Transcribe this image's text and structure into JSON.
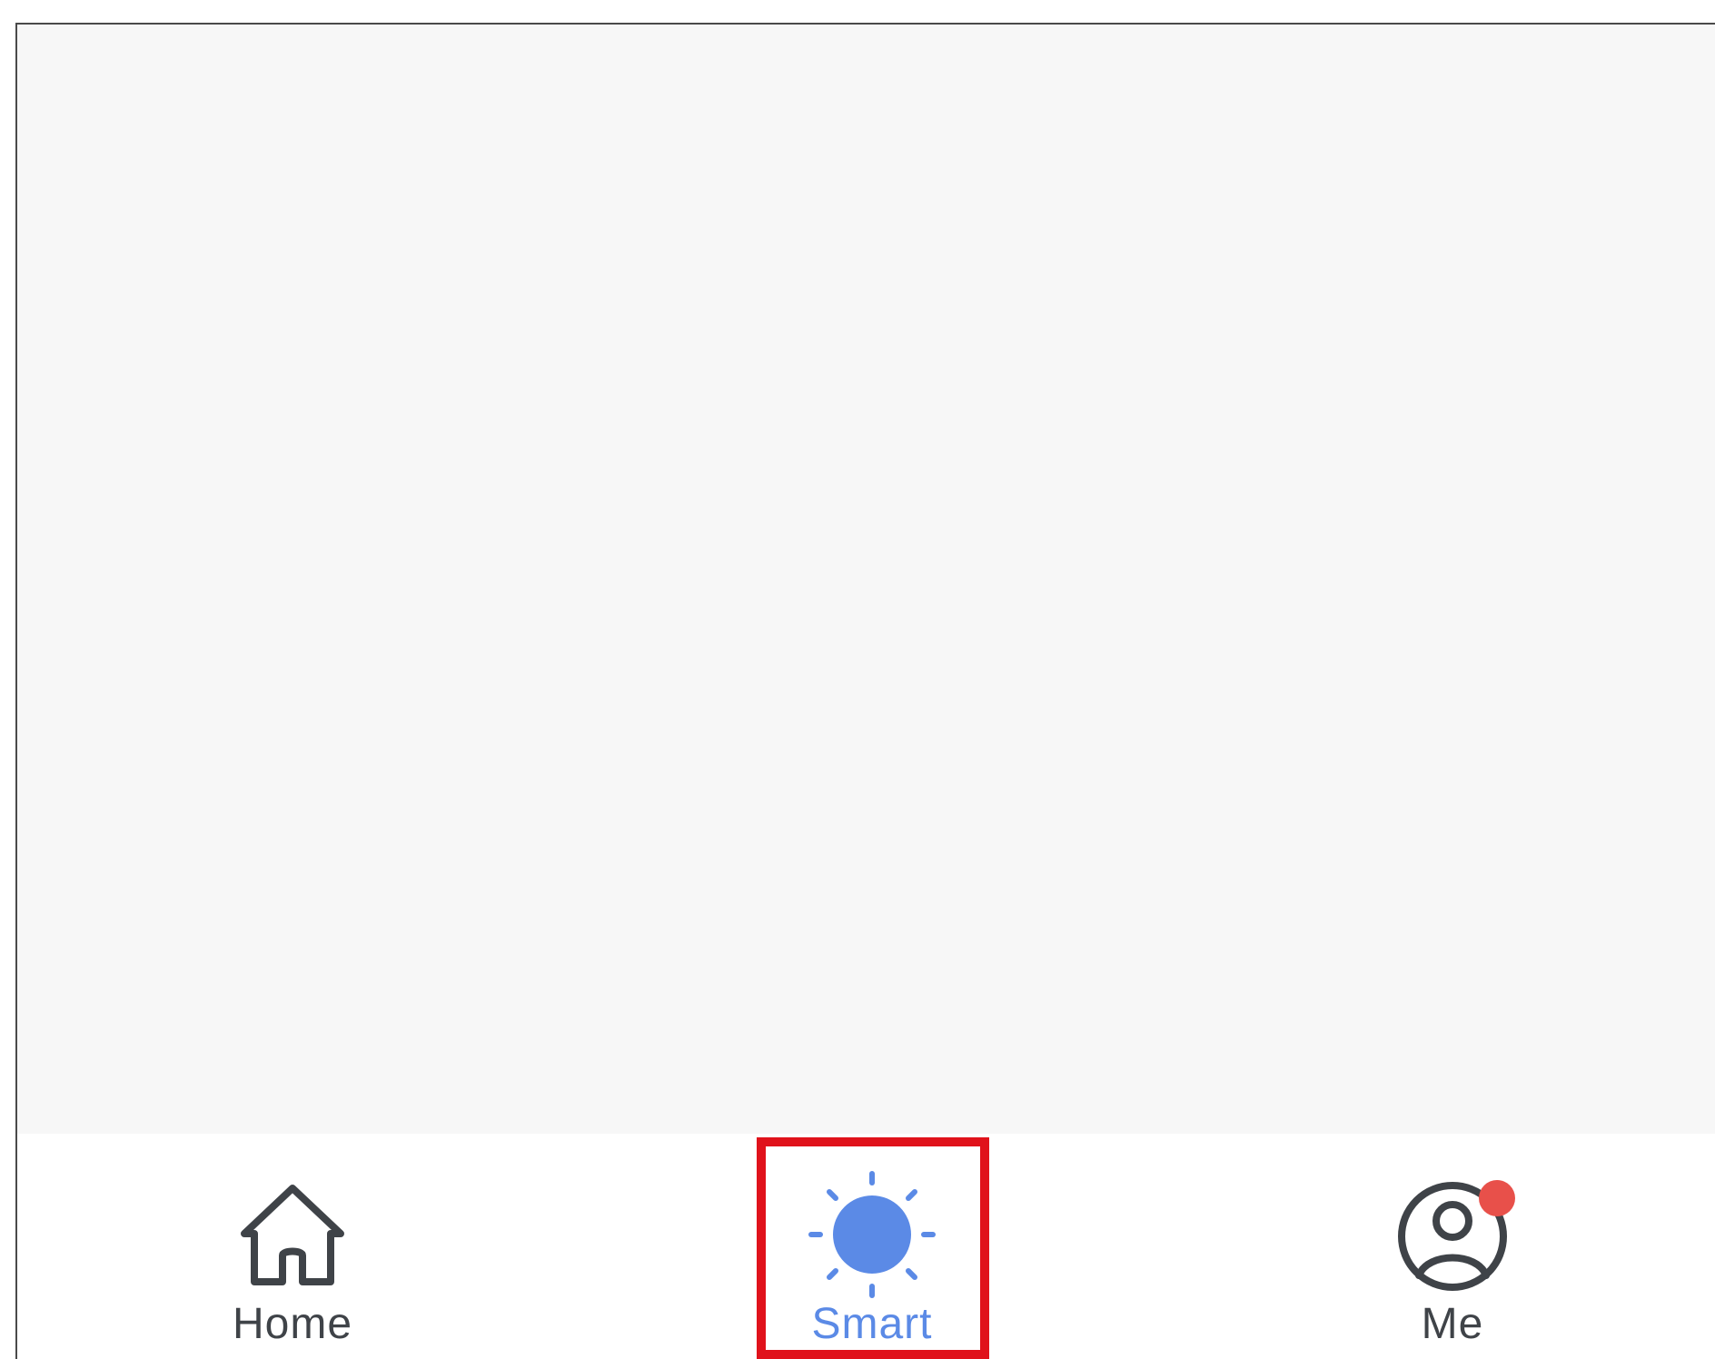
{
  "tabbar": {
    "tabs": [
      {
        "id": "home",
        "label": "Home",
        "icon": "home-icon",
        "active": false
      },
      {
        "id": "smart",
        "label": "Smart",
        "icon": "sun-icon",
        "active": true
      },
      {
        "id": "me",
        "label": "Me",
        "icon": "person-icon",
        "active": false,
        "notification_dot": true
      }
    ]
  },
  "colors": {
    "active": "#5b8ae6",
    "inactive": "#3f4348",
    "notification_dot": "#e8504a",
    "highlight": "#e0121b",
    "content_background": "#f7f7f7"
  }
}
